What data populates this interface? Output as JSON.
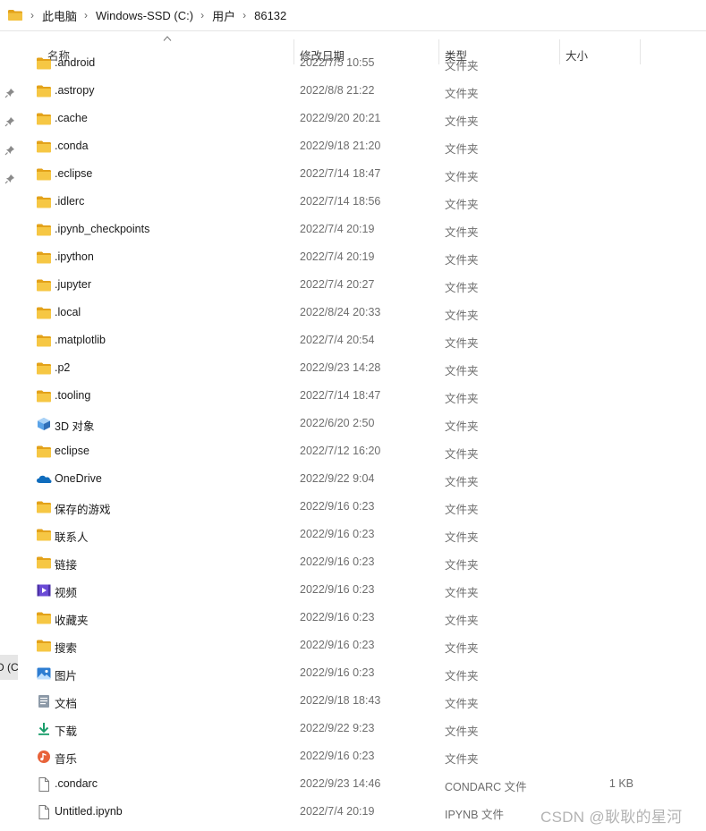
{
  "breadcrumb": {
    "items": [
      "此电脑",
      "Windows-SSD (C:)",
      "用户",
      "86132"
    ]
  },
  "columns": {
    "name": "名称",
    "date": "修改日期",
    "type": "类型",
    "size": "大小"
  },
  "nav": {
    "cut_label": "D (C"
  },
  "files": [
    {
      "name": ".android",
      "date": "2022/7/5 10:55",
      "type": "文件夹",
      "size": "",
      "icon": "folder-icon"
    },
    {
      "name": ".astropy",
      "date": "2022/8/8 21:22",
      "type": "文件夹",
      "size": "",
      "icon": "folder-icon"
    },
    {
      "name": ".cache",
      "date": "2022/9/20 20:21",
      "type": "文件夹",
      "size": "",
      "icon": "folder-icon"
    },
    {
      "name": ".conda",
      "date": "2022/9/18 21:20",
      "type": "文件夹",
      "size": "",
      "icon": "folder-icon"
    },
    {
      "name": ".eclipse",
      "date": "2022/7/14 18:47",
      "type": "文件夹",
      "size": "",
      "icon": "folder-icon"
    },
    {
      "name": ".idlerc",
      "date": "2022/7/14 18:56",
      "type": "文件夹",
      "size": "",
      "icon": "folder-icon"
    },
    {
      "name": ".ipynb_checkpoints",
      "date": "2022/7/4 20:19",
      "type": "文件夹",
      "size": "",
      "icon": "folder-icon"
    },
    {
      "name": ".ipython",
      "date": "2022/7/4 20:19",
      "type": "文件夹",
      "size": "",
      "icon": "folder-icon"
    },
    {
      "name": ".jupyter",
      "date": "2022/7/4 20:27",
      "type": "文件夹",
      "size": "",
      "icon": "folder-icon"
    },
    {
      "name": ".local",
      "date": "2022/8/24 20:33",
      "type": "文件夹",
      "size": "",
      "icon": "folder-icon"
    },
    {
      "name": ".matplotlib",
      "date": "2022/7/4 20:54",
      "type": "文件夹",
      "size": "",
      "icon": "folder-icon"
    },
    {
      "name": ".p2",
      "date": "2022/9/23 14:28",
      "type": "文件夹",
      "size": "",
      "icon": "folder-icon"
    },
    {
      "name": ".tooling",
      "date": "2022/7/14 18:47",
      "type": "文件夹",
      "size": "",
      "icon": "folder-icon"
    },
    {
      "name": "3D 对象",
      "date": "2022/6/20 2:50",
      "type": "文件夹",
      "size": "",
      "icon": "3d-objects-icon"
    },
    {
      "name": "eclipse",
      "date": "2022/7/12 16:20",
      "type": "文件夹",
      "size": "",
      "icon": "folder-icon"
    },
    {
      "name": "OneDrive",
      "date": "2022/9/22 9:04",
      "type": "文件夹",
      "size": "",
      "icon": "onedrive-icon"
    },
    {
      "name": "保存的游戏",
      "date": "2022/9/16 0:23",
      "type": "文件夹",
      "size": "",
      "icon": "folder-icon"
    },
    {
      "name": "联系人",
      "date": "2022/9/16 0:23",
      "type": "文件夹",
      "size": "",
      "icon": "folder-icon"
    },
    {
      "name": "链接",
      "date": "2022/9/16 0:23",
      "type": "文件夹",
      "size": "",
      "icon": "folder-icon"
    },
    {
      "name": "视频",
      "date": "2022/9/16 0:23",
      "type": "文件夹",
      "size": "",
      "icon": "videos-icon"
    },
    {
      "name": "收藏夹",
      "date": "2022/9/16 0:23",
      "type": "文件夹",
      "size": "",
      "icon": "folder-icon"
    },
    {
      "name": "搜索",
      "date": "2022/9/16 0:23",
      "type": "文件夹",
      "size": "",
      "icon": "folder-icon"
    },
    {
      "name": "图片",
      "date": "2022/9/16 0:23",
      "type": "文件夹",
      "size": "",
      "icon": "pictures-icon"
    },
    {
      "name": "文档",
      "date": "2022/9/18 18:43",
      "type": "文件夹",
      "size": "",
      "icon": "documents-icon"
    },
    {
      "name": "下载",
      "date": "2022/9/22 9:23",
      "type": "文件夹",
      "size": "",
      "icon": "downloads-icon"
    },
    {
      "name": "音乐",
      "date": "2022/9/16 0:23",
      "type": "文件夹",
      "size": "",
      "icon": "music-icon"
    },
    {
      "name": ".condarc",
      "date": "2022/9/23 14:46",
      "type": "CONDARC 文件",
      "size": "1 KB",
      "icon": "file-icon"
    },
    {
      "name": "Untitled.ipynb",
      "date": "2022/7/4 20:19",
      "type": "IPYNB 文件",
      "size": "",
      "icon": "file-icon"
    }
  ],
  "watermark": "CSDN @耿耿的星河",
  "colors": {
    "folder": "#f3c13f",
    "folder_dark": "#e3a21a",
    "onedrive": "#0f6cbd",
    "downloads": "#1a9e6b",
    "music": "#e8633a",
    "videos": "#6b4bd6",
    "pictures": "#2d7dd2"
  }
}
